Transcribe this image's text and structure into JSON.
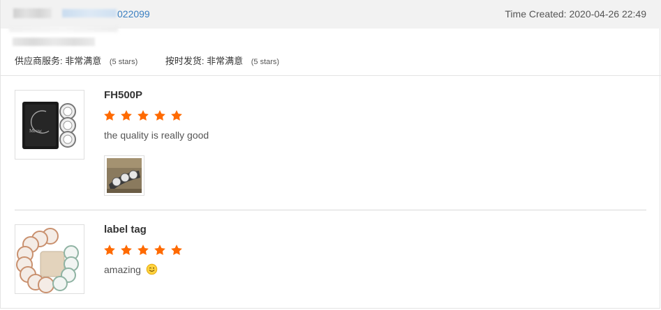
{
  "order": {
    "id_suffix": "022099",
    "time_created": "Time Created: 2020-04-26 22:49"
  },
  "supplier_ratings": [
    {
      "label": "供应商服务:",
      "value": "非常满意",
      "stars_text": "(5 stars)"
    },
    {
      "label": "按时发货:",
      "value": "非常满意",
      "stars_text": "(5 stars)"
    }
  ],
  "reviews": [
    {
      "title": "FH500P",
      "rating": 5,
      "max_rating": 5,
      "text": "the quality is really good",
      "has_photo": true
    },
    {
      "title": "label tag",
      "rating": 5,
      "max_rating": 5,
      "text": "amazing",
      "emoji": "smiling-face-icon",
      "has_photo": false
    }
  ],
  "colors": {
    "star": "#ff6a00",
    "link": "#3a7fc1",
    "header_bg": "#f2f2f2"
  }
}
